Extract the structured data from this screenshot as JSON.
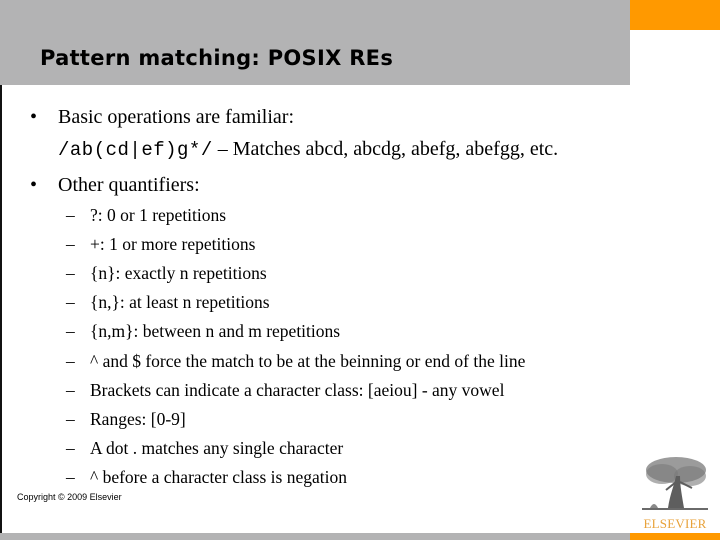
{
  "slide": {
    "title": "Pattern matching: POSIX REs",
    "bullets": [
      {
        "marker": "•",
        "text": "Basic operations are familiar:",
        "example": {
          "code": "/ab(cd|ef)g*/",
          "separator": " – ",
          "description": "Matches abcd, abcdg, abefg, abefgg, etc."
        }
      },
      {
        "marker": "•",
        "text": "Other quantifiers:",
        "sub_marker": "–",
        "sub_items": [
          "?: 0 or 1 repetitions",
          "+: 1 or more repetitions",
          "{n}: exactly n repetitions",
          "{n,}: at least n repetitions",
          "{n,m}: between n and m repetitions",
          "^ and $ force the match to be at the beinning or end of the line",
          "Brackets can indicate a character class: [aeiou] - any vowel",
          "Ranges: [0-9]",
          "A dot . matches any single character",
          "^ before a character class is negation"
        ]
      }
    ],
    "footer": {
      "copyright": "Copyright © 2009 Elsevier",
      "logo_text": "ELSEVIER",
      "logo_icon": "elsevier-tree-icon"
    }
  },
  "colors": {
    "header_gray": "#b3b3b4",
    "accent_orange": "#ff9900",
    "logo_orange": "#e8a23a"
  }
}
